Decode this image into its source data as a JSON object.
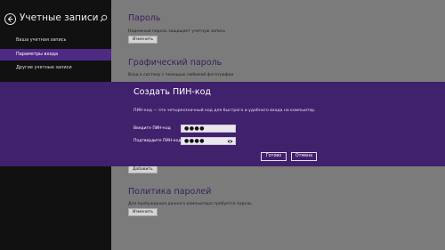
{
  "sidebar": {
    "title": "Учетные записи",
    "back_icon": "back-arrow-icon",
    "search_icon": "search-icon",
    "items": [
      {
        "label": "Ваша учетная запись",
        "active": false
      },
      {
        "label": "Параметры входа",
        "active": true
      },
      {
        "label": "Другие учетные записи",
        "active": false
      }
    ]
  },
  "content": {
    "password": {
      "title": "Пароль",
      "description": "Надежный пароль защищает учетную запись",
      "button": "Изменить"
    },
    "picture_password": {
      "title": "Графический пароль",
      "description": "Вход в систему с помощью любимой фотографии"
    },
    "pin": {
      "button": "Добавить"
    },
    "password_policy": {
      "title": "Политика паролей",
      "description": "Для пробуждения данного компьютера требуется пароль",
      "button": "Изменить"
    }
  },
  "dialog": {
    "title": "Создать ПИН-код",
    "description": "ПИН-код — это четырехзначный код для быстрого и удобного входа на компьютер.",
    "fields": [
      {
        "label": "Введите ПИН-код",
        "value": "●●●●"
      },
      {
        "label": "Подтвердите ПИН-код",
        "value": "●●●●",
        "icon": "reveal-password-icon"
      }
    ],
    "ok_label": "Готово",
    "cancel_label": "Отмена"
  },
  "colors": {
    "accent": "#4e2a84",
    "dialog_bg": "#40216c",
    "section_title": "#38215e",
    "left_pane": "#111111",
    "content_bg": "#7b7b7b"
  }
}
